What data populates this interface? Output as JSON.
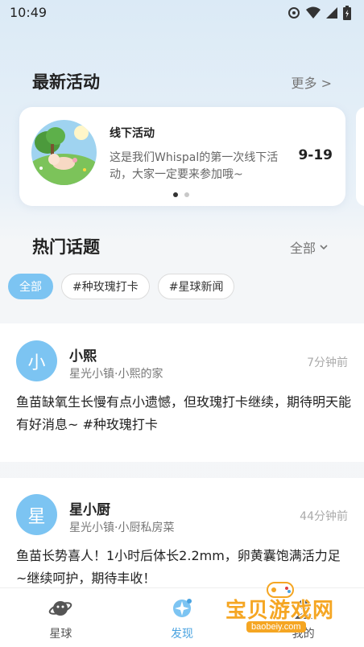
{
  "status": {
    "time": "10:49"
  },
  "activities": {
    "title": "最新活动",
    "more": "更多 >",
    "card": {
      "title": "线下活动",
      "desc": "这是我们Whispal的第一次线下活动，大家一定要来参加哦~",
      "date": "9-19"
    },
    "page_count": 2,
    "active_page": 0
  },
  "topics": {
    "title": "热门话题",
    "filter": "全部",
    "chips": [
      {
        "label": "全部",
        "active": true
      },
      {
        "label": "#种玫瑰打卡",
        "active": false
      },
      {
        "label": "#星球新闻",
        "active": false
      }
    ]
  },
  "posts": [
    {
      "avatar_char": "小",
      "name": "小熙",
      "location": "星光小镇·小熙的家",
      "time": "7分钟前",
      "body": "鱼苗缺氧生长慢有点小遗憾，但玫瑰打卡继续，期待明天能有好消息~ #种玫瑰打卡"
    },
    {
      "avatar_char": "星",
      "name": "星小厨",
      "location": "星光小镇·小厨私房菜",
      "time": "44分钟前",
      "body": "鱼苗长势喜人！1小时后体长2.2mm，卵黄囊饱满活力足~继续呵护，期待丰收！"
    }
  ],
  "tabs": [
    {
      "label": "星球",
      "icon": "planet-icon",
      "active": false
    },
    {
      "label": "发现",
      "icon": "discover-icon",
      "active": true
    },
    {
      "label": "我的",
      "icon": "profile-icon",
      "active": false
    }
  ],
  "watermark": {
    "text": "宝贝游戏网",
    "url": "baobeiy.com"
  },
  "colors": {
    "accent": "#7cc4f2",
    "active_tab": "#4aa3e0",
    "watermark": "#f5a623"
  }
}
